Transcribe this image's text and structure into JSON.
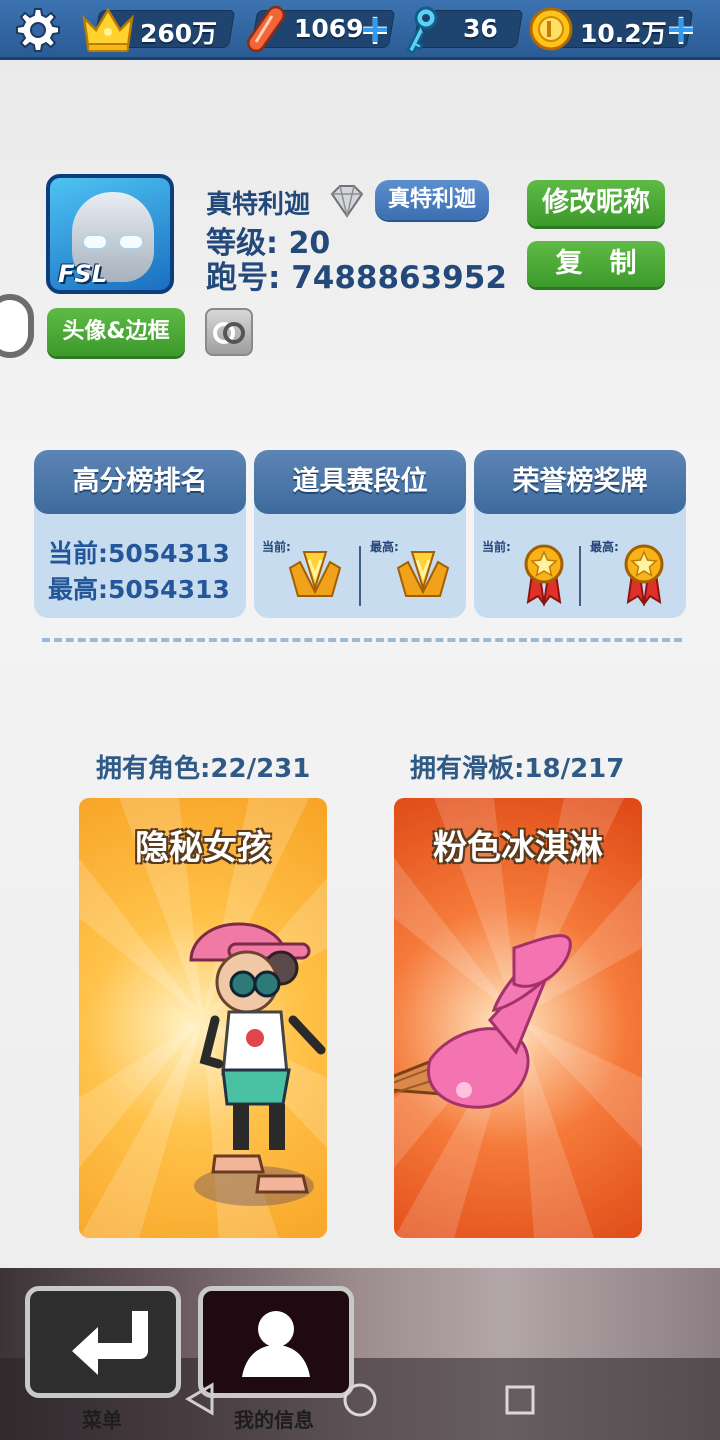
{
  "topbar": {
    "crowns": "260万",
    "boards": "1069",
    "keys": "36",
    "coins": "10.2万",
    "plus": "+"
  },
  "profile": {
    "nickname": "真特利迦",
    "title_badge": "真特利迦",
    "level": "等级: 20",
    "run_id": "跑号: 7488863952",
    "avatar_text": "FSL",
    "rename_button": "修改昵称",
    "copy_button": "复　制",
    "avatar_frame_button": "头像&边框"
  },
  "panels": {
    "score_rank": {
      "title": "高分榜排名",
      "current": "当前:5054313",
      "best": "最高:5054313"
    },
    "item_race": {
      "title": "道具赛段位",
      "current_label": "当前:",
      "best_label": "最高:"
    },
    "honor": {
      "title": "荣誉榜奖牌",
      "current_label": "当前:",
      "best_label": "最高:"
    }
  },
  "collection": {
    "characters_owned": "拥有角色:22/231",
    "boards_owned": "拥有滑板:18/217",
    "character_card": "隐秘女孩",
    "board_card": "粉色冰淇淋"
  },
  "bottom": {
    "menu": "菜单",
    "my_info": "我的信息"
  },
  "colors": {
    "topbar": "#3566a3",
    "green_button": "#4aa836",
    "panel_head": "#4d79ad",
    "card_orange": "#fbb237",
    "card_red": "#e85a20"
  }
}
